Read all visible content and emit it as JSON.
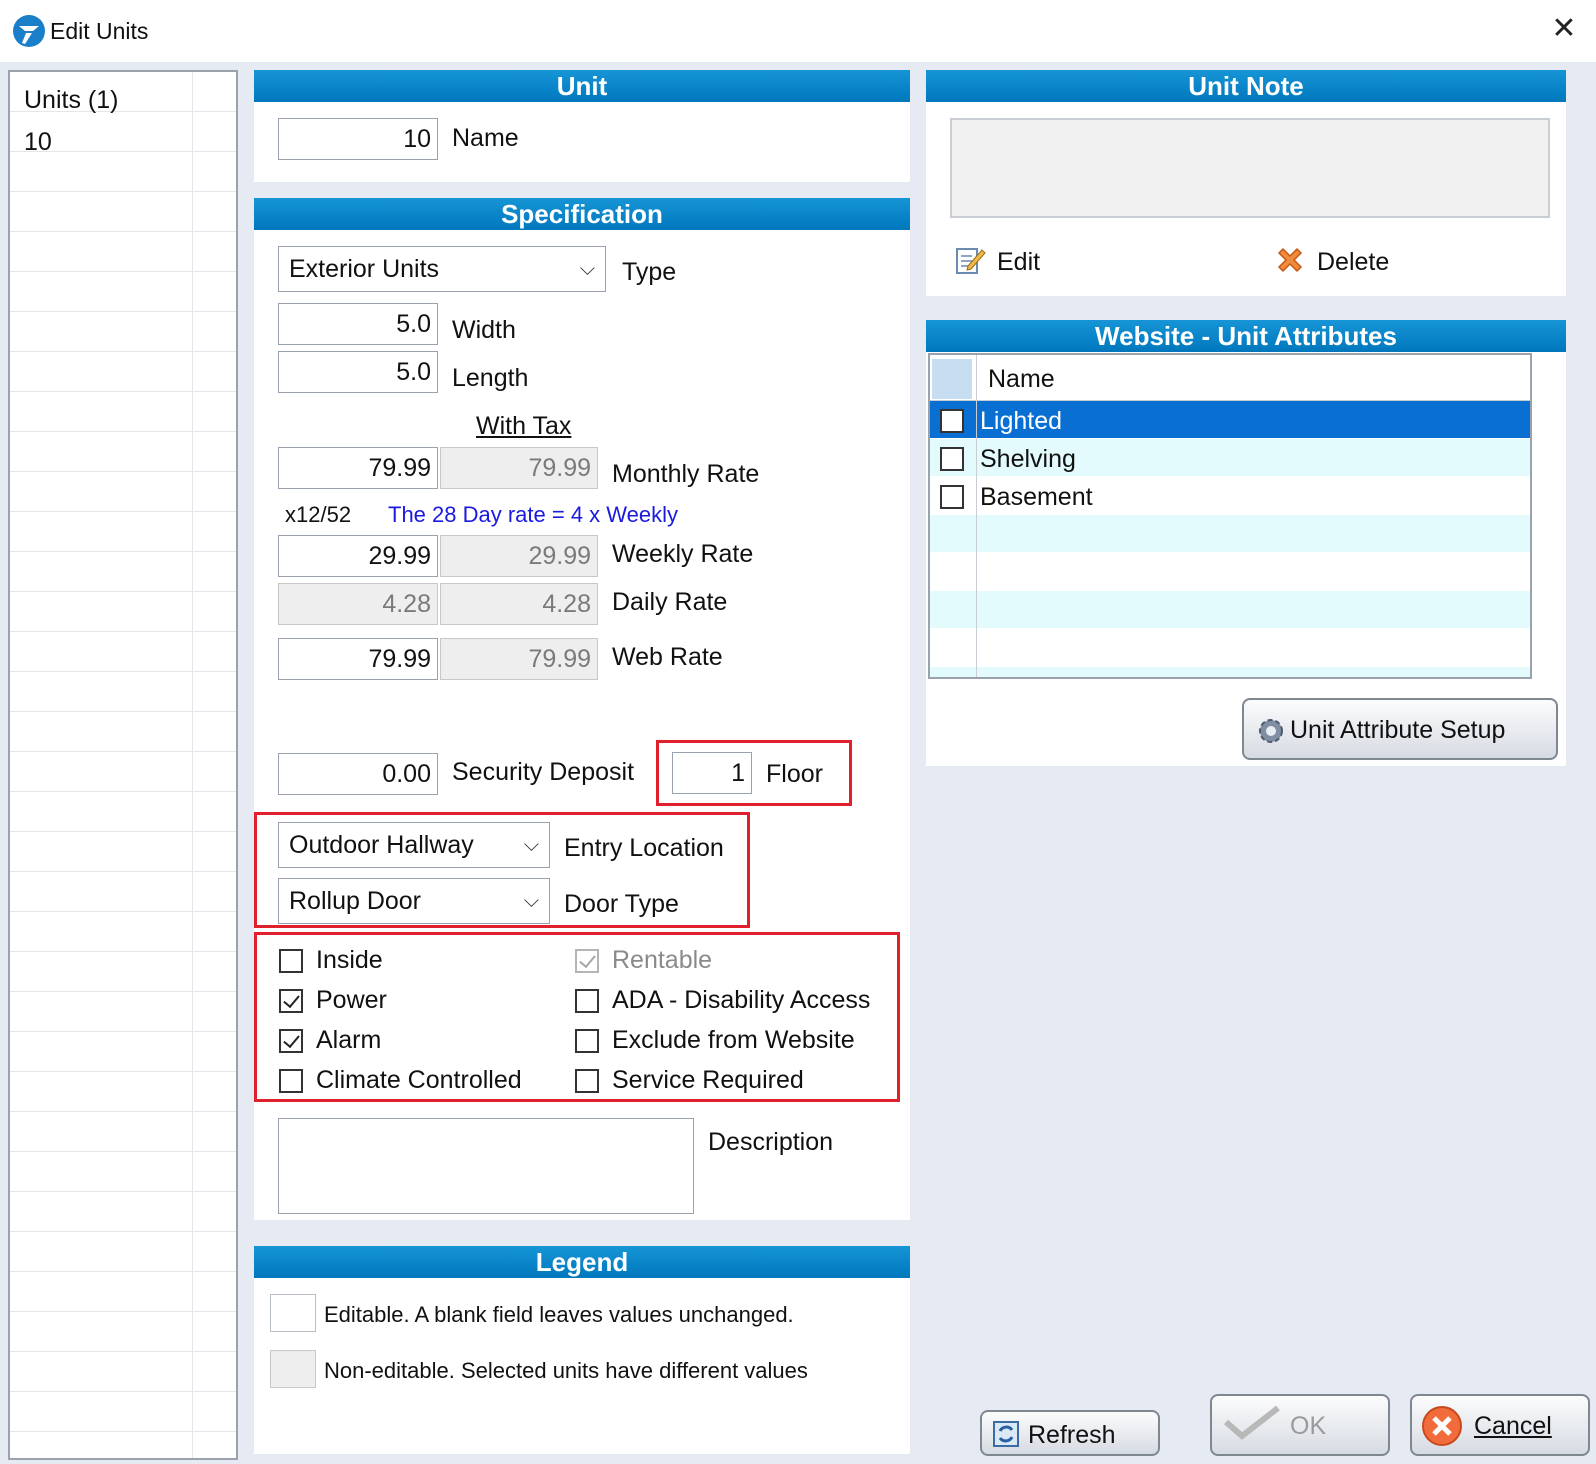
{
  "window": {
    "title": "Edit Units",
    "close_symbol": "✕",
    "icon": "app-logo-icon"
  },
  "unit_list": {
    "header": "Units (1)",
    "items": [
      "10"
    ]
  },
  "unit": {
    "header": "Unit",
    "name_value": "10",
    "name_label": "Name"
  },
  "specification": {
    "header": "Specification",
    "type_value": "Exterior Units",
    "type_label": "Type",
    "width_value": "5.0",
    "width_label": "Width",
    "length_value": "5.0",
    "length_label": "Length",
    "with_tax_label": "With Tax",
    "monthly_value": "79.99",
    "monthly_tax_value": "79.99",
    "monthly_label": "Monthly Rate",
    "multiplier_note": "x12/52",
    "day_rate_note": "The 28 Day rate = 4 x Weekly",
    "weekly_value": "29.99",
    "weekly_tax_value": "29.99",
    "weekly_label": "Weekly Rate",
    "daily_value": "4.28",
    "daily_tax_value": "4.28",
    "daily_label": "Daily Rate",
    "web_value": "79.99",
    "web_tax_value": "79.99",
    "web_label": "Web Rate",
    "deposit_value": "0.00",
    "deposit_label": "Security Deposit",
    "floor_value": "1",
    "floor_label": "Floor",
    "entry_location_value": "Outdoor Hallway",
    "entry_location_label": "Entry Location",
    "door_type_value": "Rollup Door",
    "door_type_label": "Door Type",
    "checkboxes": {
      "inside": {
        "label": "Inside",
        "checked": false
      },
      "power": {
        "label": "Power",
        "checked": true
      },
      "alarm": {
        "label": "Alarm",
        "checked": true
      },
      "climate": {
        "label": "Climate Controlled",
        "checked": false
      },
      "rentable": {
        "label": "Rentable",
        "checked": true,
        "disabled": true
      },
      "ada": {
        "label": "ADA - Disability Access",
        "checked": false
      },
      "exclude": {
        "label": "Exclude from Website",
        "checked": false
      },
      "service": {
        "label": "Service Required",
        "checked": false
      }
    },
    "description_label": "Description",
    "description_value": ""
  },
  "legend": {
    "header": "Legend",
    "editable_text": "Editable.  A blank field leaves values unchanged.",
    "noneditable_text": "Non-editable.  Selected units have different values"
  },
  "unit_note": {
    "header": "Unit Note",
    "note_value": "",
    "edit_label": "Edit",
    "delete_label": "Delete"
  },
  "website_attributes": {
    "header": "Website - Unit Attributes",
    "column_name": "Name",
    "rows": [
      {
        "name": "Lighted",
        "checked": false,
        "selected": true
      },
      {
        "name": "Shelving",
        "checked": false,
        "selected": false
      },
      {
        "name": "Basement",
        "checked": false,
        "selected": false
      }
    ],
    "setup_button": "Unit Attribute Setup"
  },
  "buttons": {
    "refresh": "Refresh",
    "ok": "OK",
    "cancel": "Cancel"
  },
  "colors": {
    "header_blue": "#0077bd",
    "selection_blue": "#0a6fd2",
    "alt_row": "#e3fbfd",
    "highlight_red": "#e0202a",
    "note_blue": "#1a1ae0"
  }
}
